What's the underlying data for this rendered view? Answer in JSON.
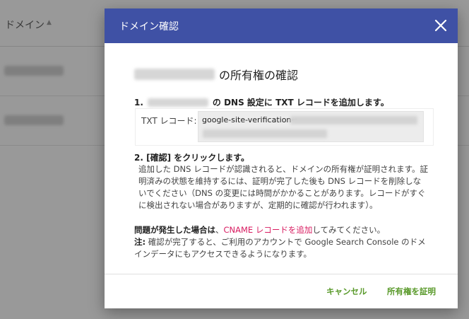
{
  "background": {
    "column_header": "ドメイン",
    "sort_icon": "▲"
  },
  "dialog": {
    "title": "ドメイン確認",
    "heading_suffix": "の所有権の確認",
    "step1": {
      "number": "1.",
      "text": "の DNS 設定に TXT レコードを追加します。"
    },
    "txt_record": {
      "label": "TXT レコード:",
      "value_prefix": "google-site-verification="
    },
    "step2": {
      "title": "2. [確認] をクリックします。",
      "body": "追加した DNS レコードが認識されると、ドメインの所有権が証明されます。証明済みの状態を維持するには、証明が完了した後も DNS レコードを削除しないでください（DNS の変更には時間がかかることがあります。レコードがすぐに検出されない場合がありますが、定期的に確認が行われます）。"
    },
    "issue": {
      "label": "問題が発生した場合は",
      "separator": "、",
      "link": "CNAME レコードを追加",
      "suffix": "してみてください。"
    },
    "note": {
      "label": "注:",
      "text": " 確認が完了すると、ご利用のアカウントで Google Search Console のドメインデータにもアクセスできるようになります。"
    },
    "buttons": {
      "cancel": "キャンセル",
      "verify": "所有権を証明"
    }
  },
  "colors": {
    "header_bg": "#3f51a5",
    "button_text": "#5a9a2b",
    "link": "#d81b60"
  }
}
